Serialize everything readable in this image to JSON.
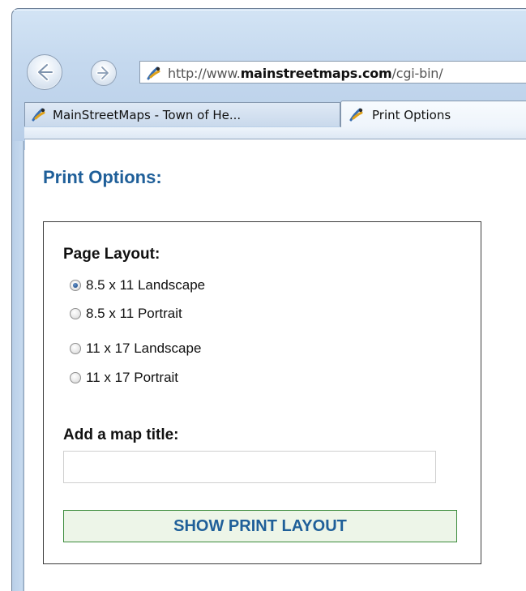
{
  "browser": {
    "address": {
      "prefix": "http://www.",
      "domain": "mainstreetmaps.com",
      "path": "/cgi-bin/"
    },
    "tabs": [
      {
        "label": "MainStreetMaps - Town of He...",
        "active": false,
        "icon": "map-pin-icon"
      },
      {
        "label": "Print Options",
        "active": true,
        "icon": "map-pin-icon"
      }
    ],
    "nav": {
      "back_icon": "back-arrow-icon",
      "forward_icon": "forward-arrow-icon"
    }
  },
  "page": {
    "title": "Print Options:",
    "layout_label": "Page Layout:",
    "layout_options": [
      {
        "label": "8.5 x 11 Landscape",
        "checked": true
      },
      {
        "label": "8.5 x 11 Portrait",
        "checked": false
      },
      {
        "label": "11 x 17 Landscape",
        "checked": false
      },
      {
        "label": "11 x 17 Portrait",
        "checked": false
      }
    ],
    "map_title_label": "Add a map title:",
    "map_title_value": "",
    "button_label": "SHOW PRINT LAYOUT"
  },
  "colors": {
    "title": "#1f5f99",
    "button_bg": "#edf5e8",
    "button_border": "#3a8a3a"
  }
}
